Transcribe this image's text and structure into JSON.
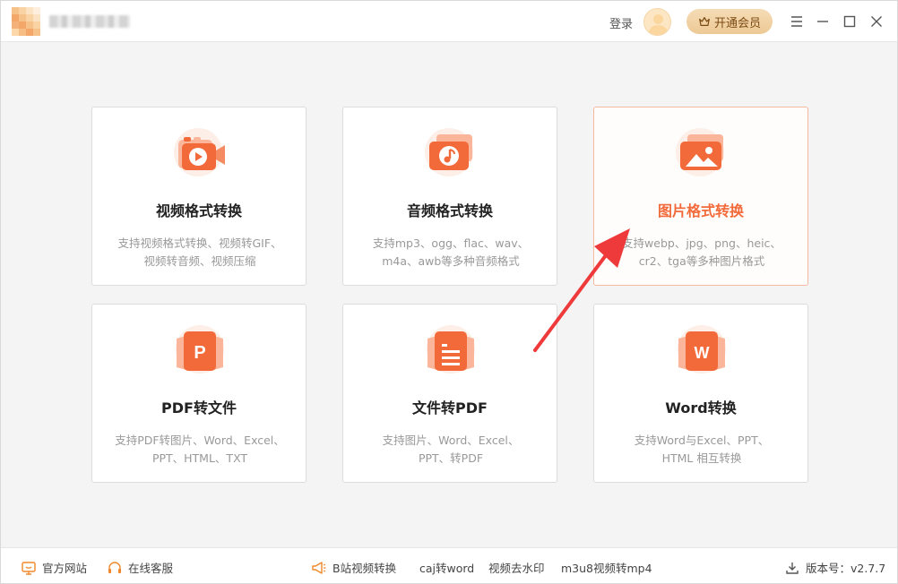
{
  "header": {
    "login_label": "登录",
    "vip_label": "开通会员"
  },
  "cards": [
    {
      "title": "视频格式转换",
      "desc_line1": "支持视频格式转换、视频转GIF、",
      "desc_line2": "视频转音频、视频压缩",
      "icon": "video-icon"
    },
    {
      "title": "音频格式转换",
      "desc_line1": "支持mp3、ogg、flac、wav、",
      "desc_line2": "m4a、awb等多种音频格式",
      "icon": "audio-icon"
    },
    {
      "title": "图片格式转换",
      "desc_line1": "支持webp、jpg、png、heic、",
      "desc_line2": "cr2、tga等多种图片格式",
      "icon": "image-icon"
    },
    {
      "title": "PDF转文件",
      "desc_line1": "支持PDF转图片、Word、Excel、",
      "desc_line2": "PPT、HTML、TXT",
      "icon": "pdf-icon"
    },
    {
      "title": "文件转PDF",
      "desc_line1": "支持图片、Word、Excel、",
      "desc_line2": "PPT、转PDF",
      "icon": "file-icon"
    },
    {
      "title": "Word转换",
      "desc_line1": "支持Word与Excel、PPT、",
      "desc_line2": "HTML 相互转换",
      "icon": "word-icon"
    }
  ],
  "footer": {
    "website": "官方网站",
    "service": "在线客服",
    "links": [
      "B站视频转换",
      "caj转word",
      "视频去水印",
      "m3u8视频转mp4"
    ],
    "version": "版本号：v2.7.7"
  },
  "colors": {
    "accent": "#f26a3a",
    "accent_light": "#fbb59a",
    "vip_bg": "#edc995"
  }
}
